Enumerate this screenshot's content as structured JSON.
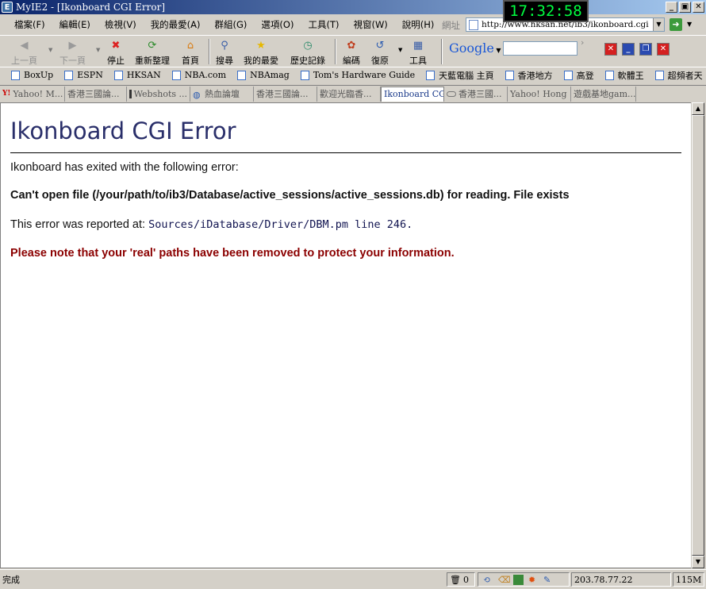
{
  "window": {
    "title": "MyIE2 - [Ikonboard CGI Error]",
    "clock": "17:32:58",
    "controls": {
      "minimize": "_",
      "maximize": "▣",
      "close": "✕"
    }
  },
  "menu": [
    "檔案(F)",
    "編輯(E)",
    "檢視(V)",
    "我的最愛(A)",
    "群組(G)",
    "選項(O)",
    "工具(T)",
    "視窗(W)",
    "說明(H)"
  ],
  "address": {
    "label": "網址",
    "url": "http://www.hksan.net/ib3/ikonboard.cgi"
  },
  "toolbar": {
    "back": "上一頁",
    "forward": "下一頁",
    "stop": "停止",
    "refresh": "重新整理",
    "home": "首頁",
    "search": "搜尋",
    "favorites": "我的最愛",
    "history": "歷史記錄",
    "encoding": "編碼",
    "restore": "復原",
    "tools": "工具"
  },
  "google": {
    "brand": "Google"
  },
  "links": [
    "BoxUp",
    "ESPN",
    "HKSAN",
    "NBA.com",
    "NBAmag",
    "Tom's Hardware Guide",
    "天藍電腦 主頁",
    "香港地方",
    "高登",
    "軟體王",
    "超頻者天"
  ],
  "tabs": [
    {
      "label": "Yahoo! M...",
      "active": false
    },
    {
      "label": "香港三國論...",
      "active": false
    },
    {
      "label": "Webshots ...",
      "active": false
    },
    {
      "label": "熱血論壇",
      "active": false
    },
    {
      "label": "香港三國論...",
      "active": false
    },
    {
      "label": "歡迎光臨香...",
      "active": false
    },
    {
      "label": "Ikonboard CG...",
      "active": true
    },
    {
      "label": "香港三國...",
      "active": false
    },
    {
      "label": "Yahoo! Hong ...",
      "active": false
    },
    {
      "label": "遊戲基地gam...",
      "active": false
    }
  ],
  "page": {
    "heading": "Ikonboard CGI Error",
    "intro": "Ikonboard has exited with the following error:",
    "error": "Can't open file (/your/path/to/ib3/Database/active_sessions/active_sessions.db) for reading. File exists",
    "reported_prefix": "This error was reported at: ",
    "reported_location": "Sources/iDatabase/Driver/DBM.pm line 246.",
    "note": "Please note that your 'real' paths have been removed to protect your information."
  },
  "status": {
    "text": "完成",
    "trash_count": "0",
    "ip": "203.78.77.22",
    "memory": "115M"
  }
}
